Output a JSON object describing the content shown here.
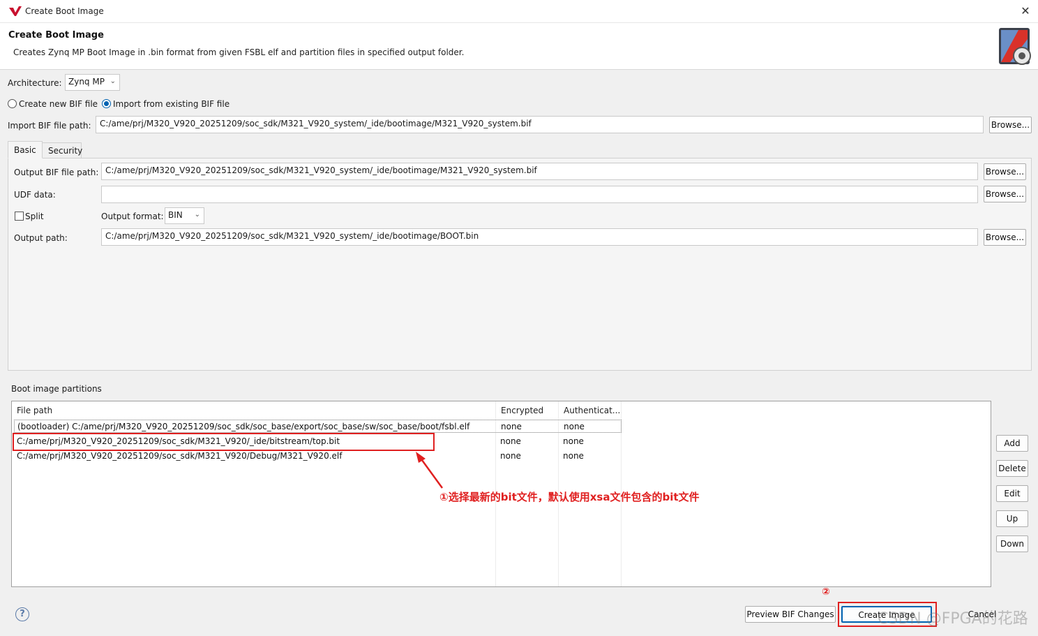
{
  "window": {
    "title": "Create Boot Image",
    "close_glyph": "✕"
  },
  "header": {
    "title": "Create Boot Image",
    "description": "Creates Zynq MP Boot Image in .bin format from given FSBL elf and partition files in specified output folder.",
    "icon": "boot-image-gear-icon"
  },
  "form": {
    "architecture_label": "Architecture:",
    "architecture_value": "Zynq MP",
    "radio_new_label": "Create new BIF file",
    "radio_import_label": "Import from existing BIF file",
    "import_bif_label": "Import BIF file path:",
    "import_bif_value": "C:/ame/prj/M320_V920_20251209/soc_sdk/M321_V920_system/_ide/bootimage/M321_V920_system.bif",
    "browse_label": "Browse..."
  },
  "tabs": {
    "basic": "Basic",
    "security": "Security"
  },
  "basic": {
    "output_bif_label": "Output BIF file path:",
    "output_bif_value": "C:/ame/prj/M320_V920_20251209/soc_sdk/M321_V920_system/_ide/bootimage/M321_V920_system.bif",
    "udf_label": "UDF data:",
    "udf_value": "",
    "split_label": "Split",
    "output_format_label": "Output format:",
    "output_format_value": "BIN",
    "output_path_label": "Output path:",
    "output_path_value": "C:/ame/prj/M320_V920_20251209/soc_sdk/M321_V920_system/_ide/bootimage/BOOT.bin"
  },
  "partitions": {
    "section_label": "Boot image partitions",
    "columns": [
      "File path",
      "Encrypted",
      "Authenticat..."
    ],
    "rows": [
      {
        "path": "(bootloader) C:/ame/prj/M320_V920_20251209/soc_sdk/soc_base/export/soc_base/sw/soc_base/boot/fsbl.elf",
        "encrypted": "none",
        "auth": "none"
      },
      {
        "path": "C:/ame/prj/M320_V920_20251209/soc_sdk/M321_V920/_ide/bitstream/top.bit",
        "encrypted": "none",
        "auth": "none"
      },
      {
        "path": "C:/ame/prj/M320_V920_20251209/soc_sdk/M321_V920/Debug/M321_V920.elf",
        "encrypted": "none",
        "auth": "none"
      }
    ],
    "buttons": {
      "add": "Add",
      "delete": "Delete",
      "edit": "Edit",
      "up": "Up",
      "down": "Down"
    }
  },
  "annotations": {
    "note1": "①选择最新的bit文件，默认使用xsa文件包含的bit文件",
    "note2": "②"
  },
  "footer": {
    "help_glyph": "?",
    "preview_label": "Preview BIF Changes",
    "create_label": "Create Image",
    "cancel_label": "Cancel",
    "watermark": "CSDN @FPGA的花路"
  },
  "colors": {
    "accent": "#0063b1",
    "annotation_red": "#e02020"
  }
}
